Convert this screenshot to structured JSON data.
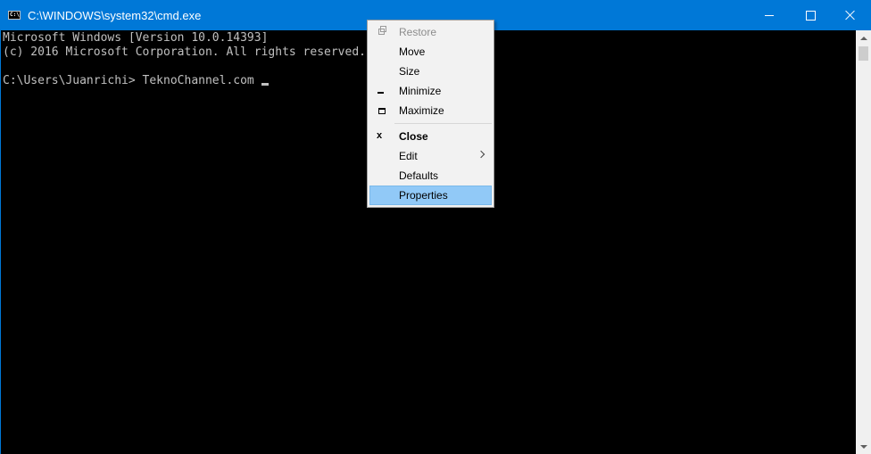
{
  "window": {
    "title": "C:\\WINDOWS\\system32\\cmd.exe",
    "icon": "C:\\"
  },
  "console": {
    "lines": [
      "Microsoft Windows [Version 10.0.14393]",
      "(c) 2016 Microsoft Corporation. All rights reserved.",
      "C:\\Users\\Juanrichi> TeknoChannel.com "
    ]
  },
  "system_menu": {
    "items": [
      {
        "label": "Restore",
        "icon": "restore-icon",
        "state": "disabled"
      },
      {
        "label": "Move"
      },
      {
        "label": "Size"
      },
      {
        "label": "Minimize",
        "icon": "minimize-icon"
      },
      {
        "label": "Maximize",
        "icon": "maximize-icon"
      },
      {
        "label": "Close",
        "icon": "close-icon",
        "bold": true
      },
      {
        "label": "Edit",
        "submenu": true
      },
      {
        "label": "Defaults"
      },
      {
        "label": "Properties",
        "state": "highlighted"
      }
    ]
  },
  "colors": {
    "titlebar": "#0078d7",
    "console_bg": "#000000",
    "console_text": "#c0c0c0",
    "menu_highlight": "#91c9f7"
  }
}
